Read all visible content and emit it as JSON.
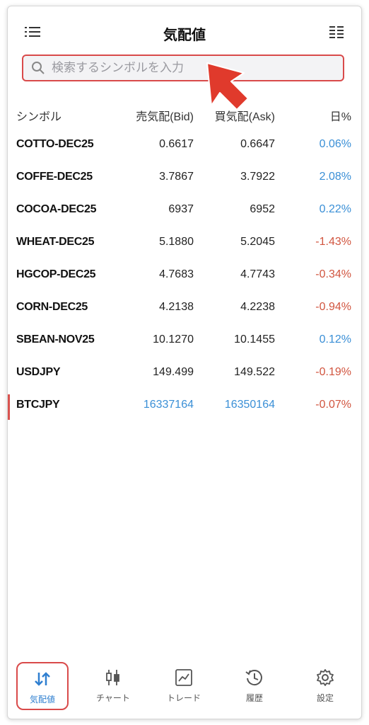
{
  "header": {
    "title": "気配値"
  },
  "search": {
    "placeholder": "検索するシンボルを入力"
  },
  "columns": {
    "symbol": "シンボル",
    "bid": "売気配(Bid)",
    "ask": "買気配(Ask)",
    "change": "日%"
  },
  "quotes": [
    {
      "symbol": "COTTO-DEC25",
      "bid": "0.6617",
      "ask": "0.6647",
      "change": "0.06%",
      "direction": "up"
    },
    {
      "symbol": "COFFE-DEC25",
      "bid": "3.7867",
      "ask": "3.7922",
      "change": "2.08%",
      "direction": "up"
    },
    {
      "symbol": "COCOA-DEC25",
      "bid": "6937",
      "ask": "6952",
      "change": "0.22%",
      "direction": "up"
    },
    {
      "symbol": "WHEAT-DEC25",
      "bid": "5.1880",
      "ask": "5.2045",
      "change": "-1.43%",
      "direction": "down"
    },
    {
      "symbol": "HGCOP-DEC25",
      "bid": "4.7683",
      "ask": "4.7743",
      "change": "-0.34%",
      "direction": "down"
    },
    {
      "symbol": "CORN-DEC25",
      "bid": "4.2138",
      "ask": "4.2238",
      "change": "-0.94%",
      "direction": "down"
    },
    {
      "symbol": "SBEAN-NOV25",
      "bid": "10.1270",
      "ask": "10.1455",
      "change": "0.12%",
      "direction": "up"
    },
    {
      "symbol": "USDJPY",
      "bid": "149.499",
      "ask": "149.522",
      "change": "-0.19%",
      "direction": "down"
    },
    {
      "symbol": "BTCJPY",
      "bid": "16337164",
      "ask": "16350164",
      "change": "-0.07%",
      "direction": "down",
      "selected": true,
      "price_color": "blue"
    }
  ],
  "tabs": [
    {
      "label": "気配値",
      "icon": "quotes-arrows-icon",
      "active": true
    },
    {
      "label": "チャート",
      "icon": "candlestick-icon"
    },
    {
      "label": "トレード",
      "icon": "trade-chart-icon"
    },
    {
      "label": "履歴",
      "icon": "history-clock-icon"
    },
    {
      "label": "設定",
      "icon": "gear-icon"
    }
  ],
  "colors": {
    "up": "#3a8fd6",
    "down": "#d1553f",
    "accent": "#2f7fd0",
    "highlight": "#d94a4a"
  }
}
